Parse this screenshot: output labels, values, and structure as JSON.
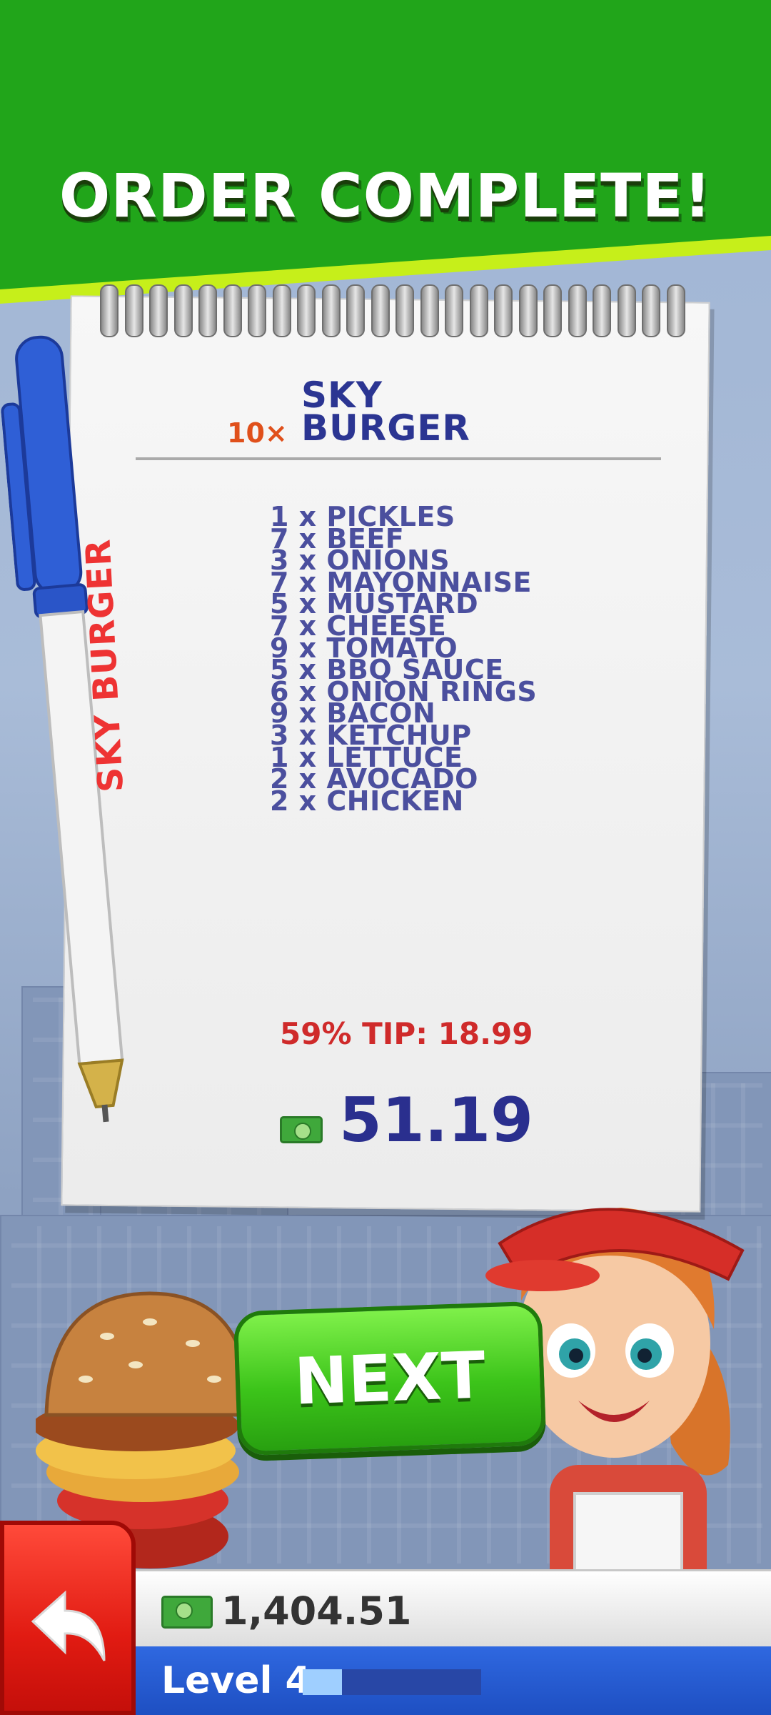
{
  "header": {
    "title": "ORDER COMPLETE!"
  },
  "order": {
    "multiplier": "10×",
    "name_line1": "SKY",
    "name_line2": "BURGER",
    "ingredients": [
      "1 x PICKLES",
      "7 x BEEF",
      "3 x ONIONS",
      "7 x MAYONNAISE",
      "5 x MUSTARD",
      "7 x CHEESE",
      "9 x TOMATO",
      "5 x BBQ SAUCE",
      "6 x ONION RINGS",
      "9 x BACON",
      "3 x KETCHUP",
      "1 x LETTUCE",
      "2 x AVOCADO",
      "2 x CHICKEN"
    ],
    "tip": "59% TIP: 18.99",
    "total": "51.19"
  },
  "pen": {
    "label": "SKY BURGER"
  },
  "buttons": {
    "next_label": "NEXT"
  },
  "status": {
    "money": "1,404.51",
    "level_label": "Level 4",
    "level_progress": 0.22
  },
  "icons": {
    "back": "back-arrow-icon",
    "cash": "cash-icon"
  },
  "colors": {
    "header_green": "#21a51a",
    "header_stripe": "#c6ef1a",
    "text_navy": "#2b3592",
    "tip_red": "#cf2a2a",
    "next_green": "#3cc41a",
    "level_blue": "#1e4fc2",
    "back_red": "#e11b12"
  }
}
